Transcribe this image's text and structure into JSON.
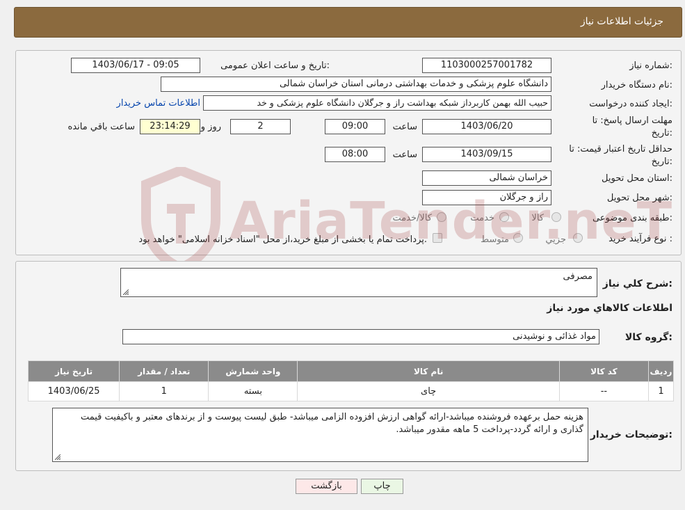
{
  "header": {
    "title": "جزئیات اطلاعات نیاز"
  },
  "form": {
    "need_number_label": "شماره نیاز:",
    "need_number": "1103000257001782",
    "announce_label": "تاریخ و ساعت اعلان عمومی:",
    "announce_value": "1403/06/17 - 09:05",
    "buyer_org_label": "نام دستگاه خریدار:",
    "buyer_org": "دانشگاه علوم پزشکی و خدمات بهداشتی درمانی استان خراسان شمالی",
    "creator_label": "ایجاد کننده درخواست:",
    "creator": "حبیب الله بهمن کاربرداز شبکه بهداشت راز و جرگلان دانشگاه علوم پزشکی و خد",
    "contact_link": "اطلاعات تماس خریدار",
    "deadline_label_1": "مهلت ارسال پاسخ: تا",
    "deadline_label_2": "تاریخ:",
    "deadline_date": "1403/06/20",
    "time_label": "ساعت",
    "deadline_time": "09:00",
    "days": "2",
    "days_label": "روز و",
    "remaining_time": "23:14:29",
    "remaining_label": "ساعت باقي مانده",
    "validity_label_1": "حداقل تاریخ اعتبار قیمت: تا",
    "validity_label_2": "تاریخ:",
    "validity_date": "1403/09/15",
    "validity_time": "08:00",
    "province_label": "استان محل تحویل:",
    "province": "خراسان شمالی",
    "city_label": "شهر محل تحویل:",
    "city": "راز و جرگلان",
    "category_label": "طبقه بندی موضوعی:",
    "category_options": [
      "کالا",
      "خدمت",
      "کالا/خدمت"
    ],
    "process_label": "نوع فرآیند خرید :",
    "process_options": [
      "جزیي",
      "متوسط"
    ],
    "process_note": "پرداخت تمام یا بخشی از مبلغ خرید،از محل \"اسناد خزانه اسلامی\" خواهد بود."
  },
  "detail": {
    "description_label": "شرح کلي نياز:",
    "description": "مصرفی",
    "items_heading": "اطلاعات کالاهاي مورد نياز",
    "group_label": "گروه کالا:",
    "group_value": "مواد غذائی و نوشیدنی",
    "table": {
      "headers": [
        "رديف",
        "کد کالا",
        "نام کالا",
        "واحد شمارش",
        "تعداد / مقدار",
        "تاریخ نیاز"
      ],
      "rows": [
        [
          "1",
          "--",
          "چای",
          "بسته",
          "1",
          "1403/06/25"
        ]
      ]
    },
    "buyer_notes_label": "توضیحات خریدار:",
    "buyer_notes": "هزینه حمل برعهده فروشنده میباشد-ارائه گواهی ارزش افزوده الزامی میباشد- طبق لیست پیوست و از برندهای معتبر و باکیفیت قیمت گذاری و ارائه گردد-پرداخت 5 ماهه مقدور میباشد."
  },
  "buttons": {
    "back": "بازگشت",
    "print": "چاپ"
  },
  "watermark": {
    "text": "AriaTender.neT"
  },
  "colors": {
    "header": "#8b6a3e",
    "table_header": "#8b8b8b",
    "back_button": "#fde8e8",
    "print_button": "#eaf7e4",
    "link": "#0645ad"
  }
}
